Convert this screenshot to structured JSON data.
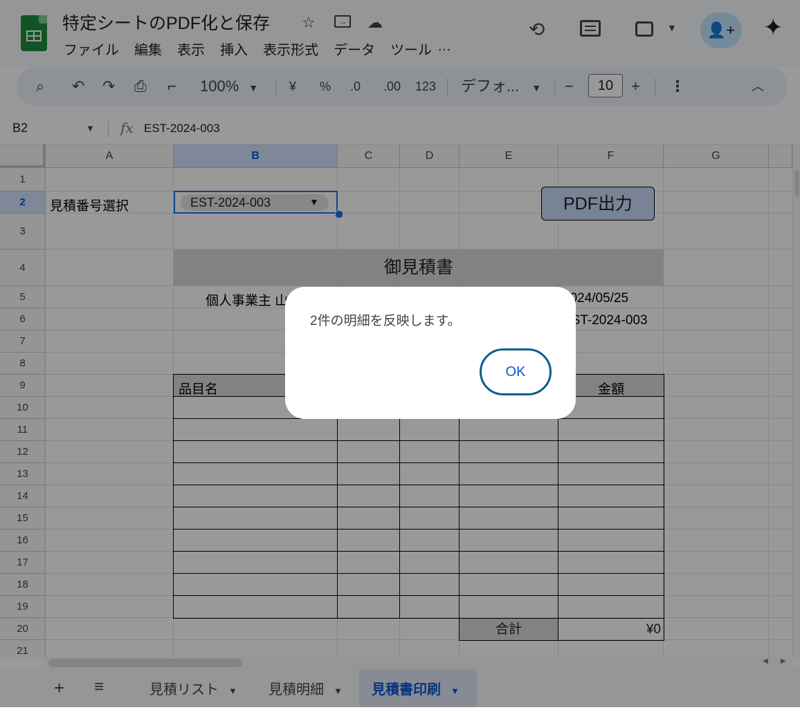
{
  "app": {
    "doc_title": "特定シートのPDF化と保存",
    "menu": [
      "ファイル",
      "編集",
      "表示",
      "挿入",
      "表示形式",
      "データ",
      "ツール",
      "…"
    ]
  },
  "toolbar": {
    "zoom": "100%",
    "currency": "¥",
    "percent": "%",
    "dec_decrease": ".0",
    "dec_increase": ".00",
    "number_format": "123",
    "font": "デフォ...",
    "font_size": "10",
    "minus": "−",
    "plus": "+"
  },
  "formula_bar": {
    "name_box": "B2",
    "fx": "fx",
    "formula": "EST-2024-003"
  },
  "grid": {
    "columns": [
      "A",
      "B",
      "C",
      "D",
      "E",
      "F",
      "G"
    ],
    "selected_column": "B",
    "rows": [
      "1",
      "2",
      "3",
      "4",
      "5",
      "6",
      "7",
      "8",
      "9",
      "10",
      "11",
      "12",
      "13",
      "14",
      "15",
      "16",
      "17",
      "18",
      "19",
      "20",
      "21"
    ],
    "selected_row": "2"
  },
  "sheet": {
    "a2": "見積番号選択",
    "b2_dropdown": "EST-2024-003",
    "pdf_button": "PDF出力",
    "title": "御見積書",
    "b5": "個人事業主 山",
    "f5": "2024/05/25",
    "f6": "EST-2024-003",
    "item_header": "品目名",
    "amount_header": "金額",
    "total_label": "合計",
    "total_value": "¥0"
  },
  "dialog": {
    "message": "2件の明細を反映します。",
    "ok_label": "OK"
  },
  "tabs": [
    {
      "label": "見積リスト"
    },
    {
      "label": "見積明細"
    },
    {
      "label": "見積書印刷"
    }
  ]
}
